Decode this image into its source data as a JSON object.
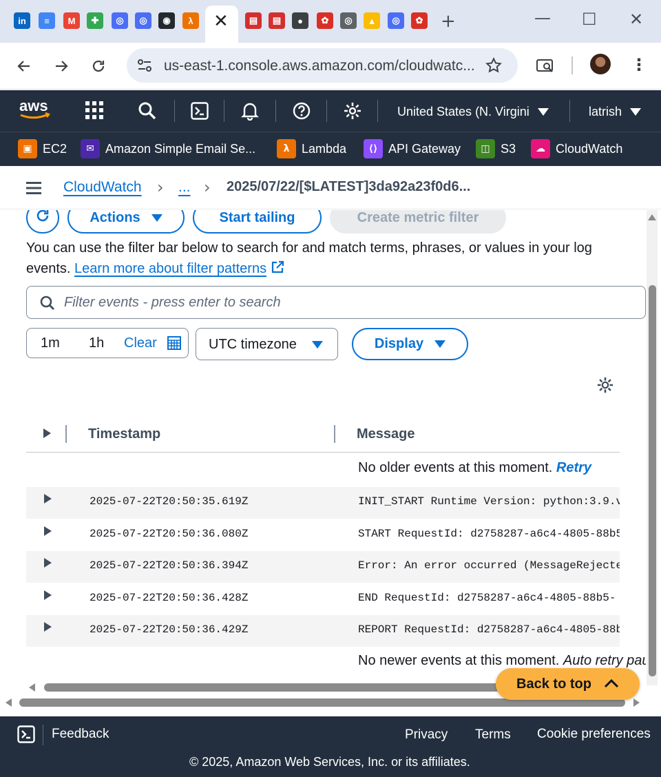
{
  "browser": {
    "tabs": [
      {
        "icon": "linkedin-icon",
        "color": "#0a66c2",
        "glyph": "in"
      },
      {
        "icon": "google-docs-icon",
        "color": "#4285f4",
        "glyph": "≡"
      },
      {
        "icon": "gmail-icon",
        "color": "#ea4335",
        "glyph": "M"
      },
      {
        "icon": "google-chat-icon",
        "color": "#34a853",
        "glyph": "✚"
      },
      {
        "icon": "site-icon",
        "color": "#4c6ef5",
        "glyph": "◎"
      },
      {
        "icon": "site-icon",
        "color": "#4c6ef5",
        "glyph": "◎"
      },
      {
        "icon": "github-icon",
        "color": "#24292f",
        "glyph": "◉"
      },
      {
        "icon": "lambda-icon",
        "color": "#ed7100",
        "glyph": "λ"
      },
      {
        "icon": "form-icon",
        "color": "#d32f2f",
        "glyph": "▤"
      },
      {
        "icon": "form-icon",
        "color": "#d32f2f",
        "glyph": "▤"
      },
      {
        "icon": "globe-icon",
        "color": "#3c4043",
        "glyph": "●"
      },
      {
        "icon": "settings-site-icon",
        "color": "#d93025",
        "glyph": "✿"
      },
      {
        "icon": "site-icon",
        "color": "#5f6368",
        "glyph": "◎"
      },
      {
        "icon": "google-drive-icon",
        "color": "#fbbc04",
        "glyph": "▲"
      },
      {
        "icon": "site-icon",
        "color": "#4c6ef5",
        "glyph": "◎"
      },
      {
        "icon": "settings-site-icon",
        "color": "#d93025",
        "glyph": "✿"
      }
    ],
    "url": "us-east-1.console.aws.amazon.com/cloudwatc..."
  },
  "aws": {
    "region": "United States (N. Virgini",
    "user": "latrish",
    "services": [
      {
        "label": "EC2",
        "icon": "ec2-icon",
        "color": "#ed7100"
      },
      {
        "label": "Amazon Simple Email Se...",
        "icon": "ses-icon",
        "color": "#4d27aa"
      },
      {
        "label": "Lambda",
        "icon": "lambda-icon",
        "color": "#ed7100"
      },
      {
        "label": "API Gateway",
        "icon": "api-gateway-icon",
        "color": "#8c4fff"
      },
      {
        "label": "S3",
        "icon": "s3-icon",
        "color": "#3f8624"
      },
      {
        "label": "CloudWatch",
        "icon": "cloudwatch-icon",
        "color": "#e7157b"
      }
    ]
  },
  "breadcrumb": {
    "root": "CloudWatch",
    "ellipsis": "...",
    "current": "2025/07/22/[$LATEST]3da92a23f0d6..."
  },
  "actions": {
    "actions_label": "Actions",
    "tailing_label": "Start tailing",
    "metric_filter_label": "Create metric filter"
  },
  "help": {
    "text": "You can use the filter bar below to search for and match terms, phrases, or values in your log events.",
    "link": "Learn more about filter patterns"
  },
  "filter": {
    "placeholder": "Filter events - press enter to search"
  },
  "range": {
    "opt1": "1m",
    "opt2": "1h",
    "clear": "Clear"
  },
  "timezone": "UTC timezone",
  "display_label": "Display",
  "table": {
    "col_timestamp": "Timestamp",
    "col_message": "Message",
    "older_note": "No older events at this moment.",
    "retry": "Retry",
    "newer_note": "No newer events at this moment.",
    "auto_retry": "Auto retry paused.",
    "rows": [
      {
        "timestamp": "2025-07-22T20:50:35.619Z",
        "message": "INIT_START Runtime Version: python:3.9.v"
      },
      {
        "timestamp": "2025-07-22T20:50:36.080Z",
        "message": "START RequestId: d2758287-a6c4-4805-88b5"
      },
      {
        "timestamp": "2025-07-22T20:50:36.394Z",
        "message": "Error: An error occurred (MessageRejected)"
      },
      {
        "timestamp": "2025-07-22T20:50:36.428Z",
        "message": "END RequestId: d2758287-a6c4-4805-88b5-"
      },
      {
        "timestamp": "2025-07-22T20:50:36.429Z",
        "message": "REPORT RequestId: d2758287-a6c4-4805-88b"
      }
    ]
  },
  "back_to_top": "Back to top",
  "footer": {
    "feedback": "Feedback",
    "privacy": "Privacy",
    "terms": "Terms",
    "cookies": "Cookie preferences",
    "copyright": "© 2025, Amazon Web Services, Inc. or its affiliates."
  }
}
